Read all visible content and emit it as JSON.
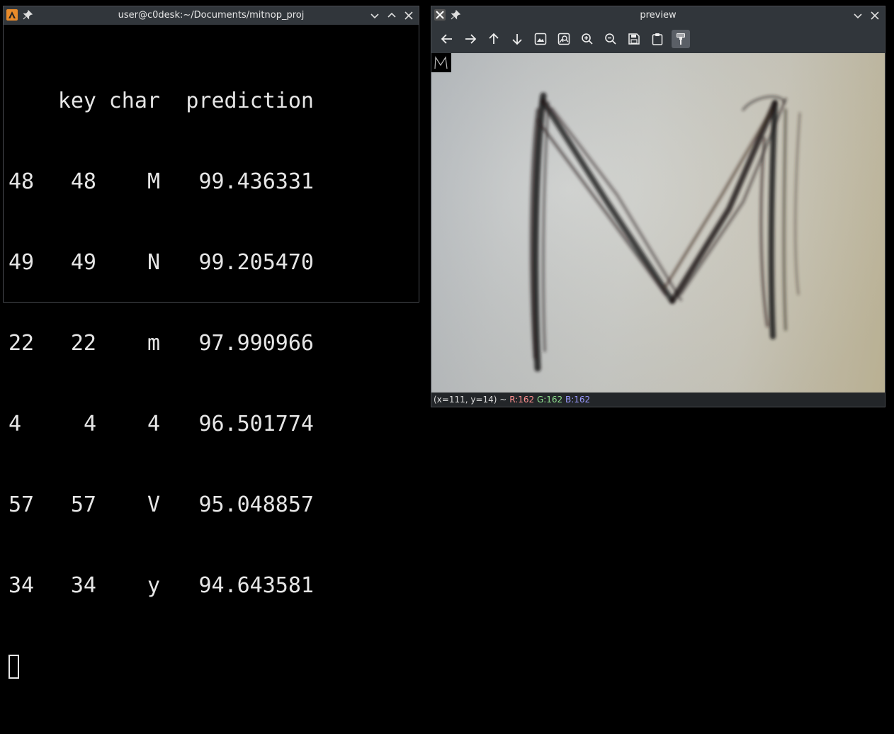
{
  "terminal": {
    "title": "user@c0desk:~/Documents/mitnop_proj",
    "header": {
      "key": "key",
      "char": "char",
      "prediction": "prediction"
    },
    "rows": [
      {
        "idx": "48",
        "key": "48",
        "char": "M",
        "prediction": "99.436331"
      },
      {
        "idx": "49",
        "key": "49",
        "char": "N",
        "prediction": "99.205470"
      },
      {
        "idx": "22",
        "key": "22",
        "char": "m",
        "prediction": "97.990966"
      },
      {
        "idx": "4",
        "key": "4",
        "char": "4",
        "prediction": "96.501774"
      },
      {
        "idx": "57",
        "key": "57",
        "char": "V",
        "prediction": "95.048857"
      },
      {
        "idx": "34",
        "key": "34",
        "char": "y",
        "prediction": "94.643581"
      }
    ]
  },
  "preview": {
    "title": "preview",
    "toolbar_icons": [
      "arrow-left-icon",
      "arrow-right-icon",
      "arrow-up-icon",
      "arrow-down-icon",
      "image-icon",
      "image-search-icon",
      "zoom-in-icon",
      "zoom-out-icon",
      "save-icon",
      "clipboard-icon",
      "paint-icon"
    ],
    "status": {
      "coords": "(x=111, y=14) ~",
      "r": "R:162",
      "g": "G:162",
      "b": "B:162"
    }
  },
  "colors": {
    "titlebar": "#31363b",
    "status_r": "#ff8f8f",
    "status_g": "#8fe08f",
    "status_b": "#9a9aff"
  }
}
